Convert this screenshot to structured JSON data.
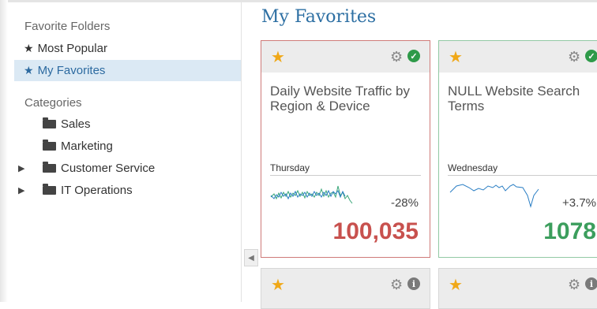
{
  "sidebar": {
    "favorite_folders_heading": "Favorite Folders",
    "folders": [
      {
        "label": "Most Popular",
        "icon": "star-icon",
        "active": false
      },
      {
        "label": "My Favorites",
        "icon": "star-icon",
        "active": true
      }
    ],
    "categories_heading": "Categories",
    "categories": [
      {
        "label": "Sales",
        "icon": "folder-icon",
        "expandable": false
      },
      {
        "label": "Marketing",
        "icon": "folder-icon",
        "expandable": false
      },
      {
        "label": "Customer Service",
        "icon": "folder-icon",
        "expandable": true
      },
      {
        "label": "IT Operations",
        "icon": "folder-icon",
        "expandable": true
      }
    ]
  },
  "main": {
    "title": "My Favorites",
    "cards": [
      {
        "title": "Daily Website Traffic by Region & Device",
        "day": "Thursday",
        "change": "-28%",
        "value": "100,035",
        "status": "ok",
        "accent": "#c8514e"
      },
      {
        "title": "NULL Website Search Terms",
        "day": "Wednesday",
        "change": "+3.7%",
        "value": "1078",
        "status": "ok",
        "accent": "#3c9e5d"
      }
    ],
    "bottom_cards": [
      {
        "status": "info"
      },
      {
        "status": "info"
      }
    ]
  },
  "colors": {
    "accent_blue": "#2d6fa3",
    "active_bg": "#dbe9f4",
    "star": "#f0a818",
    "negative": "#c8514e",
    "positive": "#3c9e5d"
  }
}
